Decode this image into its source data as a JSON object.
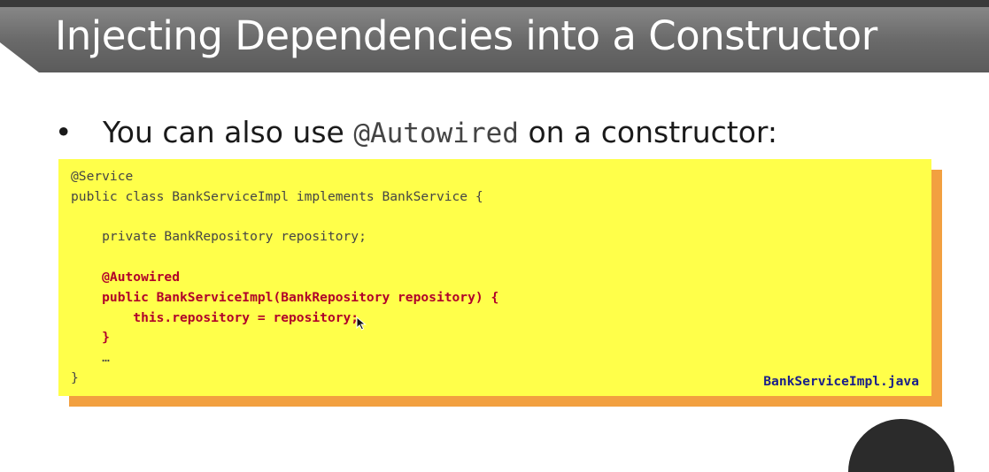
{
  "slide": {
    "title": "Injecting Dependencies into a Constructor",
    "bullet": {
      "prefix": "You can also use ",
      "code": "@Autowired",
      "suffix": " on a constructor:"
    },
    "code_block": {
      "lines": [
        {
          "text": "@Service",
          "highlight": false
        },
        {
          "text": "public class BankServiceImpl implements BankService {",
          "highlight": false
        },
        {
          "text": "",
          "highlight": false
        },
        {
          "text": "    private BankRepository repository;",
          "highlight": false
        },
        {
          "text": "",
          "highlight": false
        },
        {
          "text": "    @Autowired",
          "highlight": true
        },
        {
          "text": "    public BankServiceImpl(BankRepository repository) {",
          "highlight": true
        },
        {
          "text": "        this.repository = repository;",
          "highlight": true
        },
        {
          "text": "    }",
          "highlight": true
        },
        {
          "text": "    …",
          "highlight": false
        },
        {
          "text": "}",
          "highlight": false
        }
      ],
      "filename": "BankServiceImpl.java"
    },
    "colors": {
      "code_background": "#ffff4a",
      "code_shadow": "#f2a040",
      "highlight_text": "#b0002a",
      "filename_text": "#1a1f8a",
      "title_bar": "#6a6a6a"
    },
    "icons": {
      "bullet": "bullet-dot",
      "pointer": "mouse-pointer-icon"
    }
  }
}
